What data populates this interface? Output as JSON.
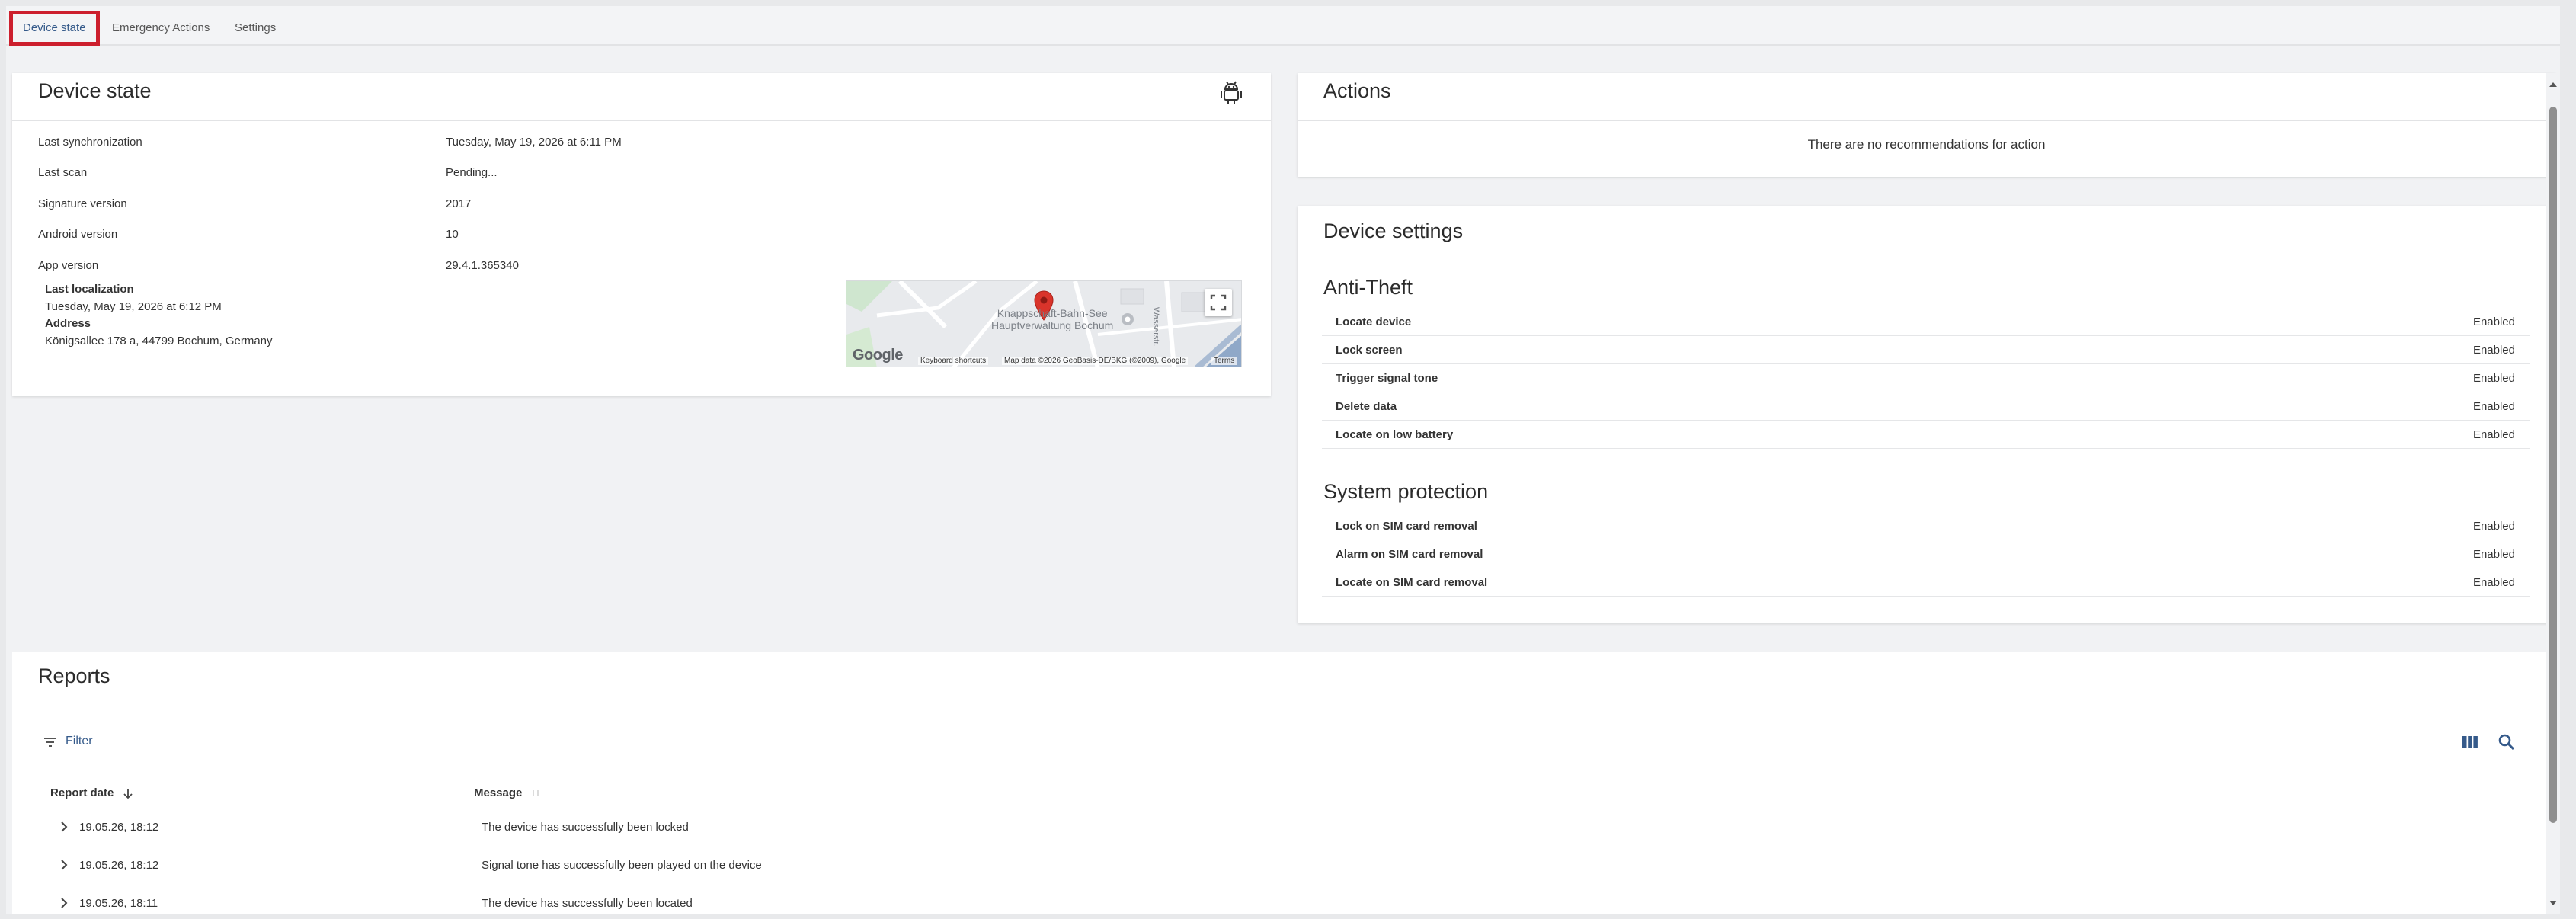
{
  "tabs": [
    {
      "label": "Device state",
      "active": true
    },
    {
      "label": "Emergency Actions",
      "active": false
    },
    {
      "label": "Settings",
      "active": false
    }
  ],
  "device_state": {
    "title": "Device state",
    "rows": [
      {
        "label": "Last synchronization",
        "value": "Tuesday, May 19, 2026 at 6:11 PM"
      },
      {
        "label": "Last scan",
        "value": "Pending..."
      },
      {
        "label": "Signature version",
        "value": "2017"
      },
      {
        "label": "Android version",
        "value": "10"
      },
      {
        "label": "App version",
        "value": "29.4.1.365340"
      }
    ],
    "localization": {
      "label": "Last localization",
      "value": "Tuesday, May 19, 2026 at 6:12 PM",
      "address_label": "Address",
      "address_value": "Königsallee 178 a, 44799 Bochum, Germany"
    },
    "map": {
      "poi_line1": "Knappschaft-Bahn-See",
      "poi_line2": "Hauptverwaltung Bochum",
      "street": "Wasserstr.",
      "logo": "Google",
      "keyboard_shortcuts": "Keyboard shortcuts",
      "attribution": "Map data ©2026 GeoBasis-DE/BKG (©2009), Google",
      "terms": "Terms"
    }
  },
  "actions": {
    "title": "Actions",
    "empty_text": "There are no recommendations for action"
  },
  "device_settings": {
    "title": "Device settings",
    "anti_theft": {
      "heading": "Anti-Theft",
      "items": [
        {
          "name": "Locate device",
          "state": "Enabled"
        },
        {
          "name": "Lock screen",
          "state": "Enabled"
        },
        {
          "name": "Trigger signal tone",
          "state": "Enabled"
        },
        {
          "name": "Delete data",
          "state": "Enabled"
        },
        {
          "name": "Locate on low battery",
          "state": "Enabled"
        }
      ]
    },
    "system_protection": {
      "heading": "System protection",
      "items": [
        {
          "name": "Lock on SIM card removal",
          "state": "Enabled"
        },
        {
          "name": "Alarm on SIM card removal",
          "state": "Enabled"
        },
        {
          "name": "Locate on SIM card removal",
          "state": "Enabled"
        }
      ]
    }
  },
  "reports": {
    "title": "Reports",
    "filter_label": "Filter",
    "columns": {
      "date": "Report date",
      "message": "Message"
    },
    "rows": [
      {
        "date": "19.05.26, 18:12",
        "message": "The device has successfully been locked"
      },
      {
        "date": "19.05.26, 18:12",
        "message": "Signal tone has successfully been played on the device"
      },
      {
        "date": "19.05.26, 18:11",
        "message": "The device has successfully been located"
      }
    ]
  },
  "colors": {
    "accent": "#355a8a",
    "highlight_border": "#cc1f2d",
    "map_pin": "#d9342b"
  }
}
